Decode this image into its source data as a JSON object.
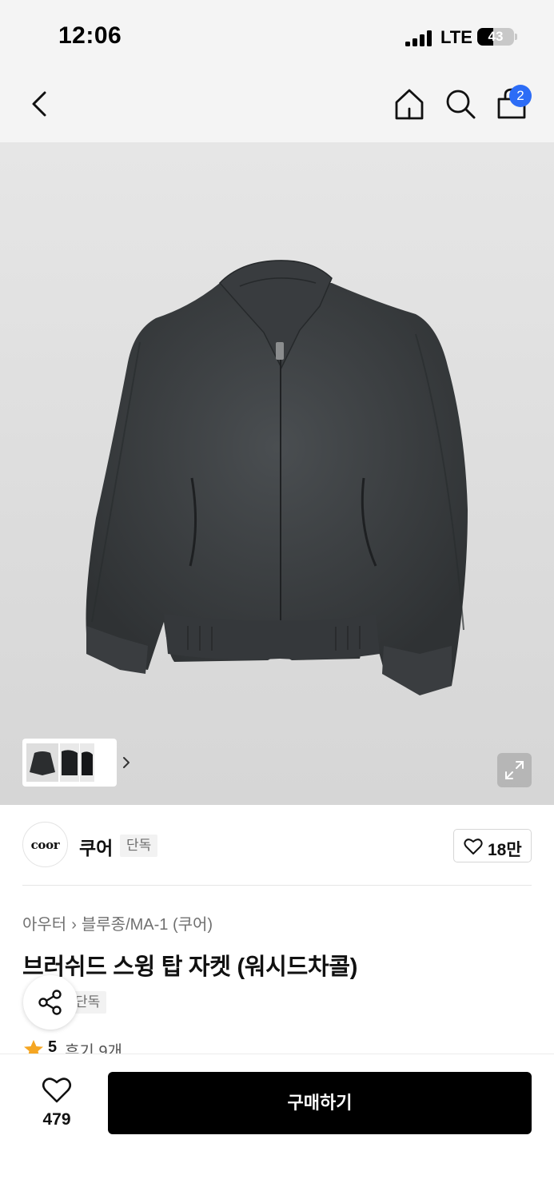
{
  "status_bar": {
    "time": "12:06",
    "network": "LTE",
    "battery_percent": 43,
    "battery_label": "43",
    "signal_bars": 4
  },
  "nav": {
    "back_icon": "chevron-left-icon",
    "home_icon": "home-icon",
    "search_icon": "search-icon",
    "cart_icon": "shopping-bag-icon",
    "cart_badge": "2",
    "badge_color": "#2c6cf6"
  },
  "gallery": {
    "thumbnail_count": 3,
    "next_icon": "chevron-right-icon",
    "expand_icon": "expand-icon"
  },
  "brand": {
    "logo_text": "coor",
    "name": "쿠어",
    "tag": "단독",
    "like_icon": "heart-outline-icon",
    "like_count": "18만"
  },
  "product": {
    "breadcrumb": [
      "아우터",
      "블루종/MA-1 (쿠어)"
    ],
    "breadcrumb_sep": "›",
    "title": "브러쉬드 스윙 탑 자켓 (워시드차콜)",
    "tag": "단독",
    "share_icon": "share-icon",
    "rating_icon": "star-icon",
    "rating_score": "5",
    "rating_color": "#f5a623",
    "reviews": "후기 9개"
  },
  "bottom_bar": {
    "wish_icon": "heart-outline-icon",
    "wish_count": "479",
    "buy_label": "구매하기",
    "buy_color": "#000000"
  }
}
